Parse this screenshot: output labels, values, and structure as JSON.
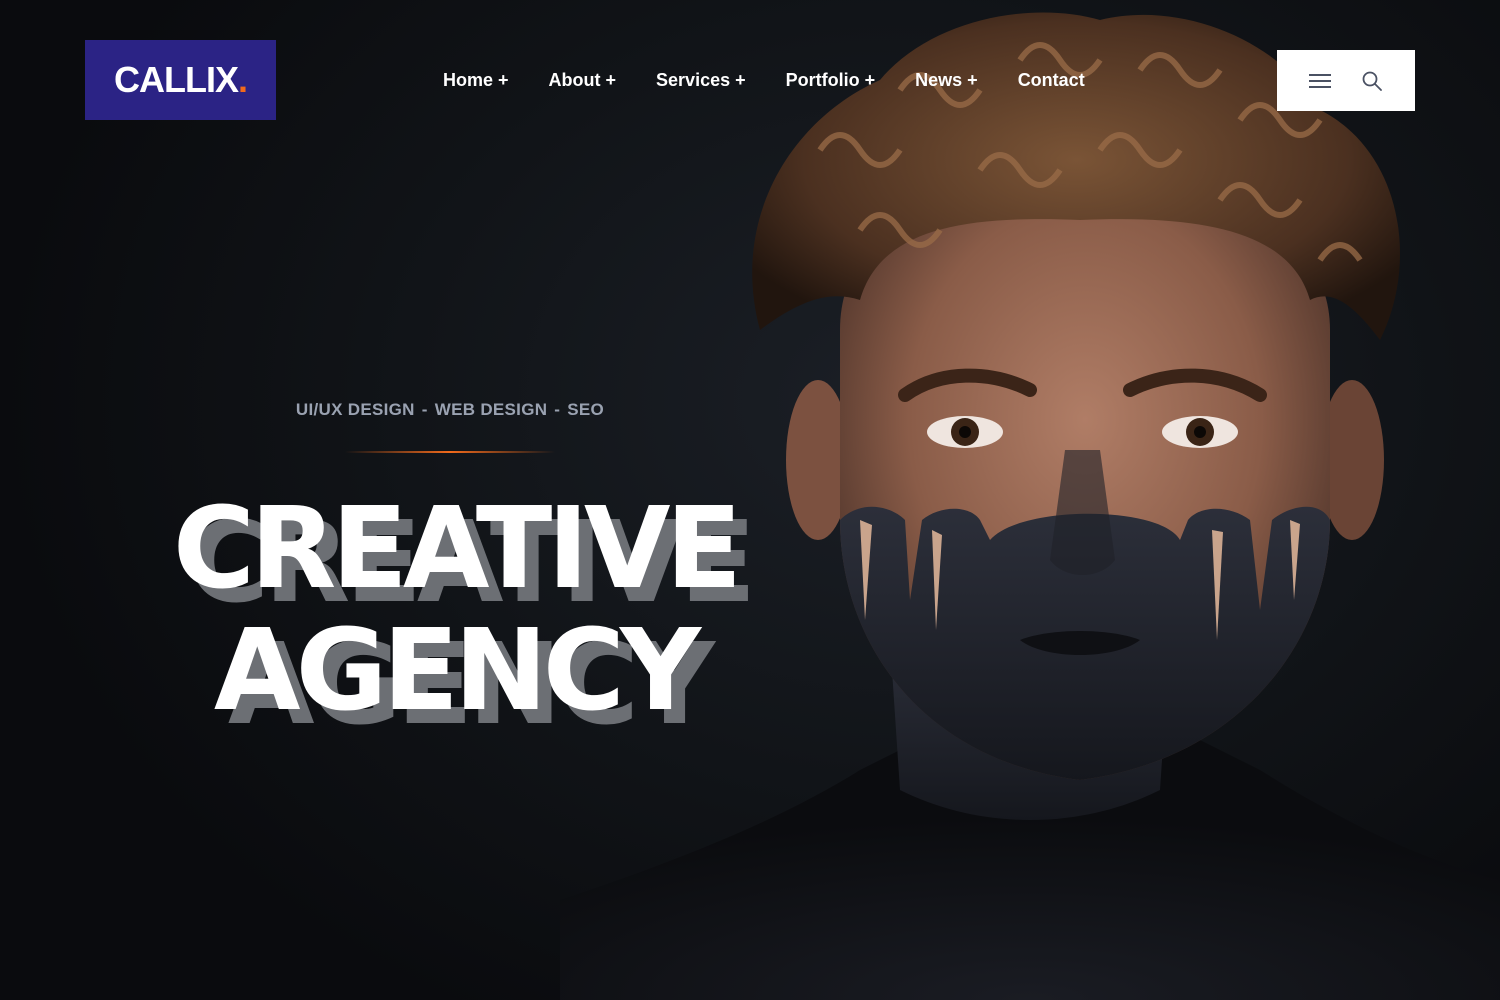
{
  "brand": {
    "name": "CALLIX",
    "dot": ".",
    "colors": {
      "logo_bg": "#2b2385",
      "accent": "#f26a1b"
    }
  },
  "nav": {
    "items": [
      {
        "label": "Home",
        "suffix": "+"
      },
      {
        "label": "About",
        "suffix": "+"
      },
      {
        "label": "Services",
        "suffix": "+"
      },
      {
        "label": "Portfolio",
        "suffix": "+"
      },
      {
        "label": "News",
        "suffix": "+"
      },
      {
        "label": "Contact",
        "suffix": ""
      }
    ]
  },
  "tools": {
    "menu_icon": "hamburger-menu-icon",
    "search_icon": "search-icon"
  },
  "hero": {
    "tagline": [
      "UI/UX DESIGN",
      "WEB DESIGN",
      "SEO"
    ],
    "separator": "-",
    "headline_line1": "CREATIVE",
    "headline_line2": "AGENCY",
    "image_subject": "portrait of curly-haired man with black face paint"
  }
}
